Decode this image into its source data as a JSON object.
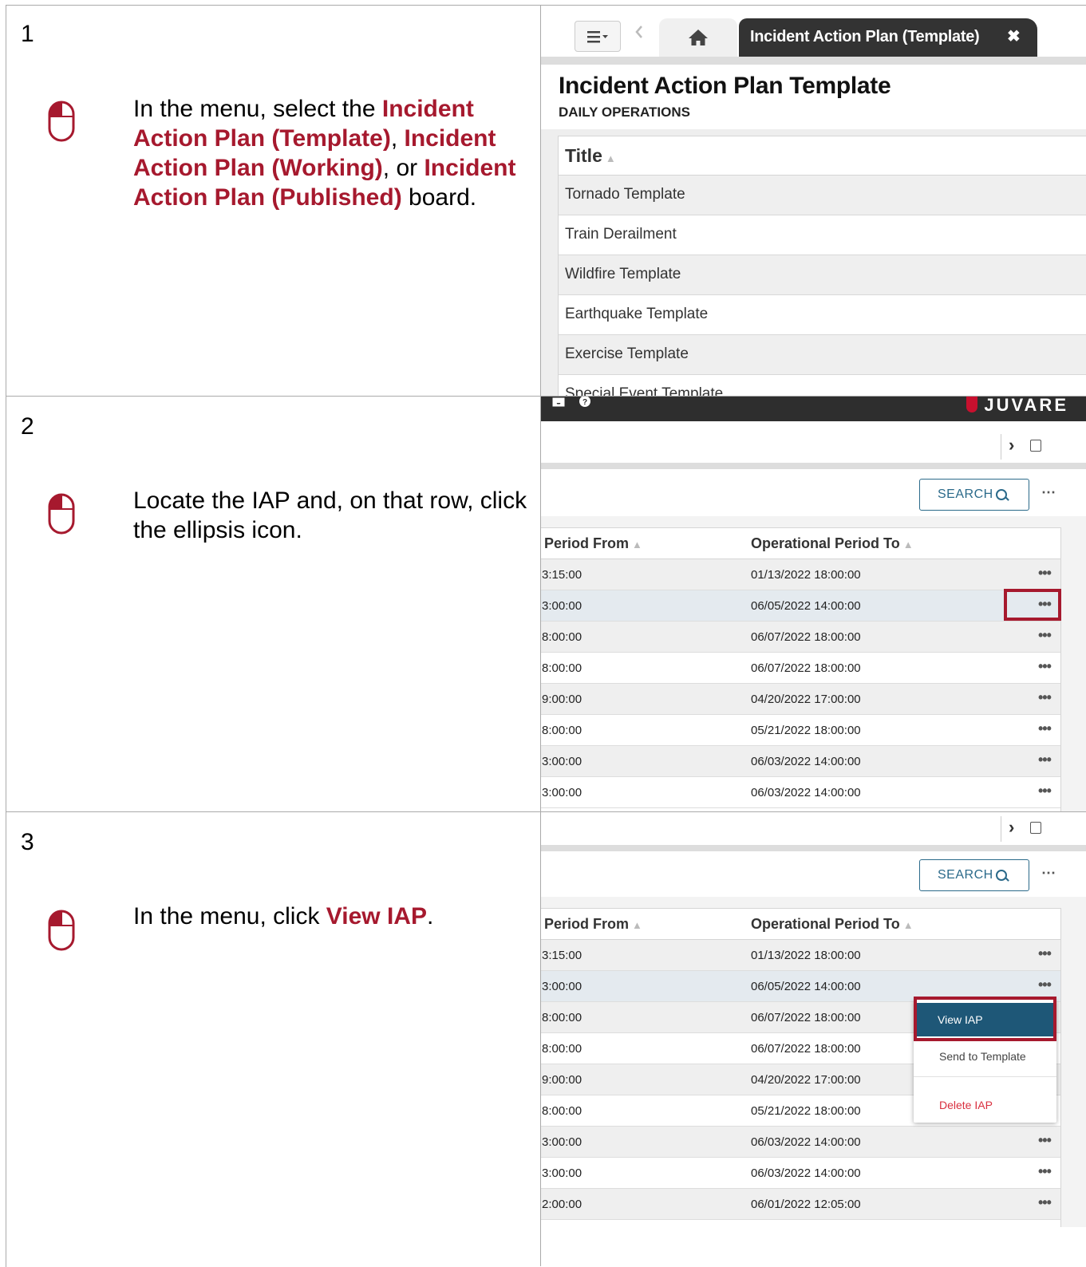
{
  "steps": [
    {
      "number": "1",
      "text_parts": [
        "In the menu, select the ",
        "Incident Action Plan (Template)",
        ", ",
        "Incident Action Plan (Working)",
        ", or ",
        "Incident Action Plan (Published)",
        " board."
      ]
    },
    {
      "number": "2",
      "text": "Locate the IAP and, on that row, click the ellipsis icon."
    },
    {
      "number": "3",
      "text_parts": [
        "In the menu, click ",
        "View IAP",
        "."
      ]
    }
  ],
  "icons": {
    "mouse": "mouse-left-click-icon",
    "menu": "hamburger-menu-icon",
    "back": "chevron-left-icon",
    "home": "home-icon",
    "close": "close-icon",
    "sort": "sort-icon",
    "search": "search-icon",
    "ellipsis": "ellipsis-icon",
    "expand": "chevron-right-icon",
    "panel": "panel-icon",
    "inbox": "inbox-icon",
    "help": "help-icon"
  },
  "colors": {
    "highlight": "#a6192e",
    "tab_active_bg": "#333333",
    "menu_selected_bg": "#1e5777",
    "delete_text": "#d9303f",
    "brand_red": "#c8102e"
  },
  "shot1": {
    "tab_home_glyph": "⌂",
    "active_tab_label": "Incident Action Plan (Template)",
    "active_tab_close": "✖",
    "page_title": "Incident Action Plan Template",
    "page_subtitle": "DAILY OPERATIONS",
    "column_header": "Title",
    "rows": [
      "Tornado Template",
      "Train Derailment",
      "Wildfire Template",
      "Earthquake Template",
      "Exercise Template",
      "Special Event Template"
    ]
  },
  "shot2": {
    "brand": "JUVARE",
    "search_label": "SEARCH",
    "column_headers": [
      "Period From",
      "Operational Period To"
    ],
    "rows": [
      {
        "from": "3:15:00",
        "to": "01/13/2022  18:00:00"
      },
      {
        "from": "3:00:00",
        "to": "06/05/2022  14:00:00"
      },
      {
        "from": "8:00:00",
        "to": "06/07/2022  18:00:00"
      },
      {
        "from": "8:00:00",
        "to": "06/07/2022  18:00:00"
      },
      {
        "from": "9:00:00",
        "to": "04/20/2022  17:00:00"
      },
      {
        "from": "8:00:00",
        "to": "05/21/2022  18:00:00"
      },
      {
        "from": "3:00:00",
        "to": "06/03/2022  14:00:00"
      },
      {
        "from": "3:00:00",
        "to": "06/03/2022  14:00:00"
      }
    ]
  },
  "shot3": {
    "search_label": "SEARCH",
    "column_headers": [
      "Period From",
      "Operational Period To"
    ],
    "rows": [
      {
        "from": "3:15:00",
        "to": "01/13/2022  18:00:00"
      },
      {
        "from": "3:00:00",
        "to": "06/05/2022  14:00:00"
      },
      {
        "from": "8:00:00",
        "to": "06/07/2022  18:00:00"
      },
      {
        "from": "8:00:00",
        "to": "06/07/2022  18:00:00"
      },
      {
        "from": "9:00:00",
        "to": "04/20/2022  17:00:00"
      },
      {
        "from": "8:00:00",
        "to": "05/21/2022  18:00:00"
      },
      {
        "from": "3:00:00",
        "to": "06/03/2022  14:00:00"
      },
      {
        "from": "3:00:00",
        "to": "06/03/2022  14:00:00"
      },
      {
        "from": "2:00:00",
        "to": "06/01/2022  12:05:00"
      }
    ],
    "context_menu": {
      "view": "View IAP",
      "send": "Send to Template",
      "delete": "Delete IAP"
    }
  }
}
